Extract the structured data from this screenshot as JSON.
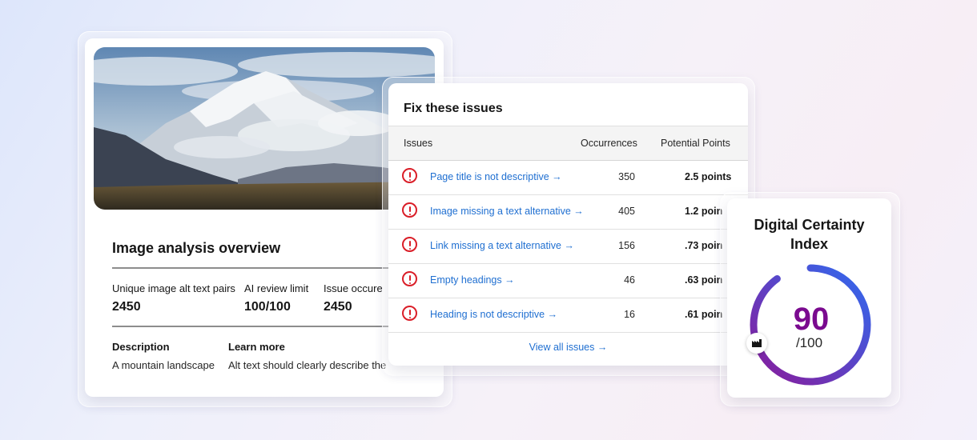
{
  "overview": {
    "title": "Image analysis overview",
    "stats": [
      {
        "label": "Unique image alt text pairs",
        "value": "2450"
      },
      {
        "label": "AI review limit",
        "value": "100/100"
      },
      {
        "label": "Issue occure",
        "value": "2450"
      }
    ],
    "description_heading": "Description",
    "description_text": "A mountain landscape",
    "learn_more_heading": "Learn more",
    "learn_more_text": "Alt text should clearly describe the"
  },
  "issues": {
    "title": "Fix these issues",
    "columns": [
      "Issues",
      "Occurrences",
      "Potential Points"
    ],
    "rows": [
      {
        "issue": "Page title is not descriptive →",
        "occurrences": "350",
        "points": "2.5 points"
      },
      {
        "issue": "Image missing a text alternative →",
        "occurrences": "405",
        "points": "1.2 poin"
      },
      {
        "issue": "Link missing a text alternative →",
        "occurrences": "156",
        "points": ".73 poin"
      },
      {
        "issue": "Empty headings →",
        "occurrences": "46",
        "points": ".63 poin"
      },
      {
        "issue": "Heading is not descriptive →",
        "occurrences": "16",
        "points": ".61 poin"
      }
    ],
    "view_all": "View all issues →"
  },
  "index": {
    "title_line1": "Digital Certainty",
    "title_line2": "Index",
    "score": "90",
    "max": "/100",
    "fraction": 0.9
  },
  "colors": {
    "link": "#1f6fd1",
    "error": "#da1e28",
    "score": "#7a0a8f",
    "gauge_start": "#8a1a9a",
    "gauge_end": "#2f6bf0"
  },
  "icons": [
    "error-icon",
    "industry-icon",
    "mountain-photo"
  ]
}
